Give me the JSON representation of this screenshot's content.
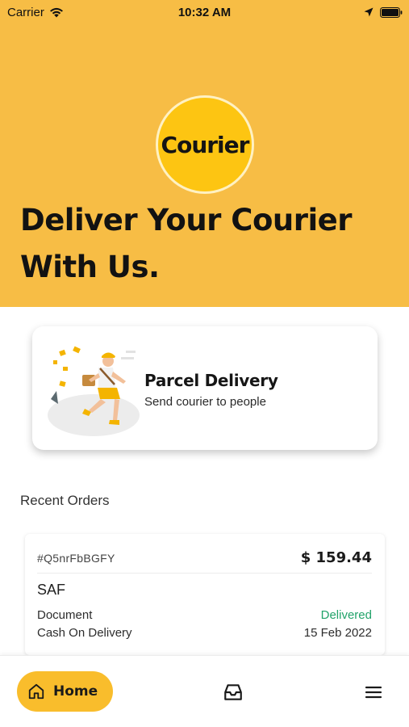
{
  "status_bar": {
    "carrier": "Carrier",
    "time": "10:32 AM"
  },
  "hero": {
    "logo_text": "Courier",
    "title_line1": "Deliver Your Courier",
    "title_line2": "With Us."
  },
  "service_card": {
    "title": "Parcel Delivery",
    "subtitle": "Send courier to people"
  },
  "recent_orders": {
    "label": "Recent Orders",
    "orders": [
      {
        "id": "#Q5nrFbBGFY",
        "amount": "$ 159.44",
        "city": "SAF",
        "type": "Document",
        "status": "Delivered",
        "payment": "Cash On Delivery",
        "date": "15 Feb 2022"
      }
    ]
  },
  "bottom_nav": {
    "home_label": "Home"
  },
  "colors": {
    "brand_yellow": "#f7bd45",
    "logo_yellow": "#fdc512",
    "delivered_green": "#22a36a"
  }
}
